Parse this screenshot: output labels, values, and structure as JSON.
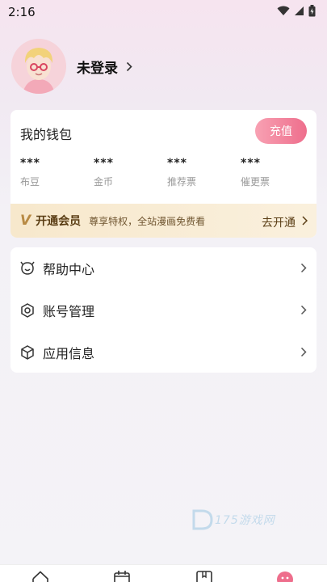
{
  "status_bar": {
    "time": "2:16"
  },
  "profile": {
    "login_text": "未登录"
  },
  "wallet": {
    "title": "我的钱包",
    "recharge_label": "充值",
    "stats": [
      {
        "value": "***",
        "label": "布豆"
      },
      {
        "value": "***",
        "label": "金币"
      },
      {
        "value": "***",
        "label": "推荐票"
      },
      {
        "value": "***",
        "label": "催更票"
      }
    ]
  },
  "vip": {
    "logo": "V",
    "title": "开通会员",
    "description": "尊享特权，全站漫画免费看",
    "action": "去开通"
  },
  "menu": {
    "items": [
      {
        "label": "帮助中心",
        "icon": "help-center-icon"
      },
      {
        "label": "账号管理",
        "icon": "account-management-icon"
      },
      {
        "label": "应用信息",
        "icon": "app-info-icon"
      }
    ]
  },
  "watermark": {
    "text": "175游戏网"
  },
  "tabbar": {
    "icons": [
      "home-icon",
      "calendar-icon",
      "bookshelf-icon",
      "profile-icon"
    ]
  },
  "colors": {
    "accent": "#ee6e8c",
    "vip_gold": "#b88a44"
  }
}
